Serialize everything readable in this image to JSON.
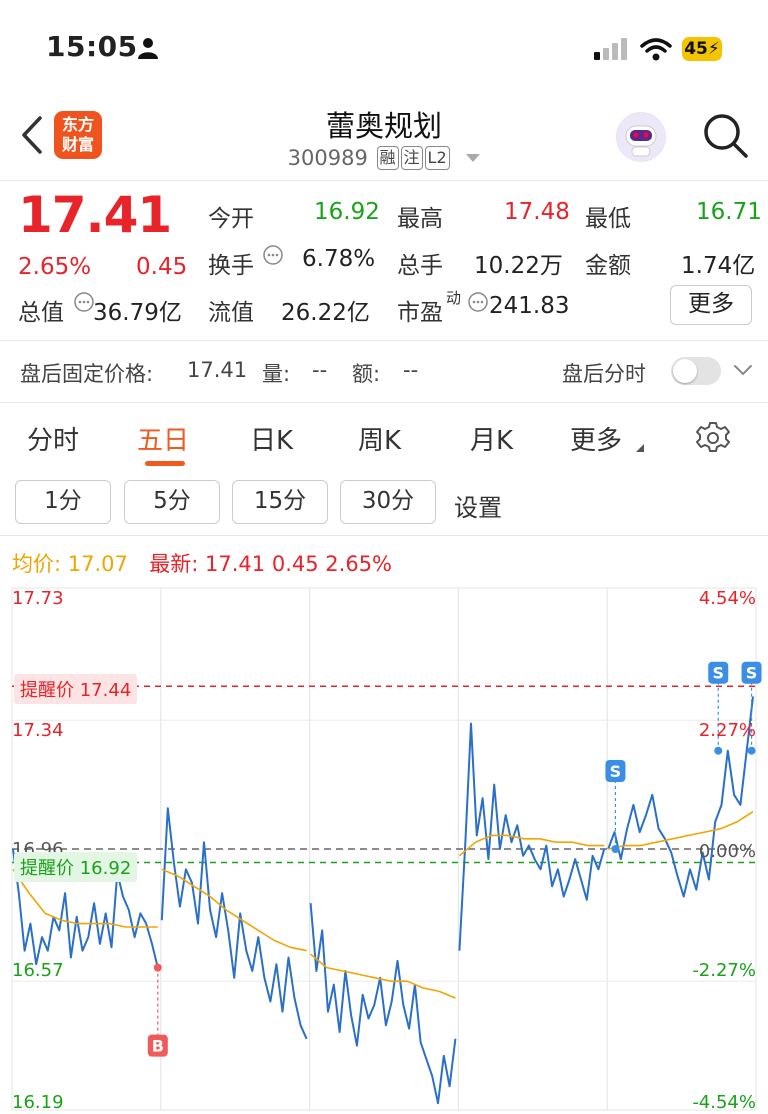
{
  "status_bar": {
    "time": "15:05",
    "battery": "45"
  },
  "header": {
    "logo_line1": "东方",
    "logo_line2": "财富",
    "stock_name": "蕾奥规划",
    "stock_code": "300989",
    "tags": [
      "融",
      "注",
      "L2"
    ]
  },
  "quote": {
    "price": "17.41",
    "change_pct": "2.65%",
    "change": "0.45",
    "fields": {
      "open_label": "今开",
      "open": "16.92",
      "high_label": "最高",
      "high": "17.48",
      "low_label": "最低",
      "low": "16.71",
      "turnover_label": "换手",
      "turnover": "6.78%",
      "volume_label": "总手",
      "volume": "10.22万",
      "amount_label": "金额",
      "amount": "1.74亿",
      "mktcap_label": "总值",
      "mktcap": "36.79亿",
      "float_label": "流值",
      "float": "26.22亿",
      "pe_label": "市盈",
      "pe_sup": "动",
      "pe": "241.83"
    },
    "more_label": "更多"
  },
  "after_hours": {
    "price_label": "盘后固定价格:",
    "price": "17.41",
    "vol_label": "量:",
    "vol": "--",
    "amt_label": "额:",
    "amt": "--",
    "toggle_label": "盘后分时"
  },
  "tabs": [
    {
      "label": "分时"
    },
    {
      "label": "五日"
    },
    {
      "label": "日K"
    },
    {
      "label": "周K"
    },
    {
      "label": "月K"
    },
    {
      "label": "更多"
    }
  ],
  "active_tab": "五日",
  "intervals": [
    "1分",
    "5分",
    "15分",
    "30分"
  ],
  "settings_label": "设置",
  "chart_legend": {
    "avg_label": "均价:",
    "avg": "17.07",
    "latest_label": "最新:",
    "latest": "17.41",
    "latest_change": "0.45",
    "latest_pct": "2.65%"
  },
  "chart_data": {
    "type": "line",
    "title": "",
    "y_left_ticks": [
      "17.73",
      "17.34",
      "16.96",
      "16.57",
      "16.19"
    ],
    "y_right_ticks": [
      "4.54%",
      "2.27%",
      "0.00%",
      "-2.27%",
      "-4.54%"
    ],
    "ylim": [
      16.19,
      17.73
    ],
    "prev_close": 16.96,
    "days": 5,
    "alerts": [
      {
        "label": "提醒价",
        "value": "17.44",
        "color": "#e8232a"
      },
      {
        "label": "提醒价",
        "value": "16.92",
        "color": "#1aa31a"
      }
    ],
    "markers": [
      {
        "type": "B",
        "day": 0,
        "pos": 1.0,
        "price": 16.61
      },
      {
        "type": "S",
        "day": 4,
        "pos": 0.05,
        "price": 16.96
      },
      {
        "type": "S",
        "day": 4,
        "pos": 0.76,
        "price": 17.25
      },
      {
        "type": "S",
        "day": 4,
        "pos": 0.99,
        "price": 17.25
      }
    ],
    "series": [
      {
        "name": "",
        "color": "#2a6fc9",
        "days": [
          [
            16.96,
            16.83,
            16.66,
            16.74,
            16.62,
            16.7,
            16.66,
            16.76,
            16.72,
            16.83,
            16.64,
            16.76,
            16.66,
            16.7,
            16.8,
            16.68,
            16.77,
            16.67,
            16.89,
            16.82,
            16.78,
            16.7,
            16.77,
            16.74,
            16.68,
            16.61
          ],
          [
            16.75,
            17.08,
            16.92,
            16.79,
            16.9,
            16.86,
            16.74,
            16.98,
            16.78,
            16.7,
            16.83,
            16.72,
            16.58,
            16.77,
            16.66,
            16.6,
            16.7,
            16.58,
            16.51,
            16.62,
            16.48,
            16.64,
            16.52,
            16.44,
            16.4
          ],
          [
            16.8,
            16.6,
            16.72,
            16.48,
            16.56,
            16.42,
            16.6,
            16.47,
            16.38,
            16.53,
            16.46,
            16.5,
            16.58,
            16.44,
            16.51,
            16.63,
            16.5,
            16.43,
            16.56,
            16.39,
            16.34,
            16.29,
            16.21,
            16.35,
            16.26,
            16.4
          ],
          [
            16.66,
            16.97,
            17.33,
            17.0,
            17.11,
            16.93,
            17.15,
            16.96,
            17.06,
            16.98,
            17.03,
            16.94,
            16.97,
            16.93,
            16.9,
            16.97,
            16.85,
            16.9,
            16.82,
            16.87,
            16.93,
            16.87,
            16.81,
            16.94,
            16.9,
            16.96
          ],
          [
            16.96,
            17.01,
            16.93,
            17.02,
            17.09,
            17.01,
            17.06,
            17.12,
            17.02,
            16.99,
            16.95,
            16.88,
            16.82,
            16.9,
            16.84,
            16.95,
            16.87,
            17.04,
            17.09,
            17.25,
            17.12,
            17.09,
            17.25,
            17.41
          ]
        ]
      },
      {
        "name": "",
        "color": "#f0a500",
        "days": [
          [
            16.9,
            16.83,
            16.77,
            16.75,
            16.74,
            16.74,
            16.74,
            16.73,
            16.73,
            16.73
          ],
          [
            16.9,
            16.88,
            16.85,
            16.82,
            16.78,
            16.75,
            16.72,
            16.69,
            16.67,
            16.66
          ],
          [
            16.65,
            16.61,
            16.6,
            16.59,
            16.58,
            16.57,
            16.57,
            16.55,
            16.54,
            16.52
          ],
          [
            16.94,
            16.98,
            17.0,
            17.0,
            16.99,
            16.99,
            16.98,
            16.98,
            16.97,
            16.97
          ],
          [
            16.96,
            16.97,
            16.97,
            16.98,
            16.99,
            17.0,
            17.01,
            17.02,
            17.04,
            17.07
          ]
        ]
      }
    ]
  }
}
